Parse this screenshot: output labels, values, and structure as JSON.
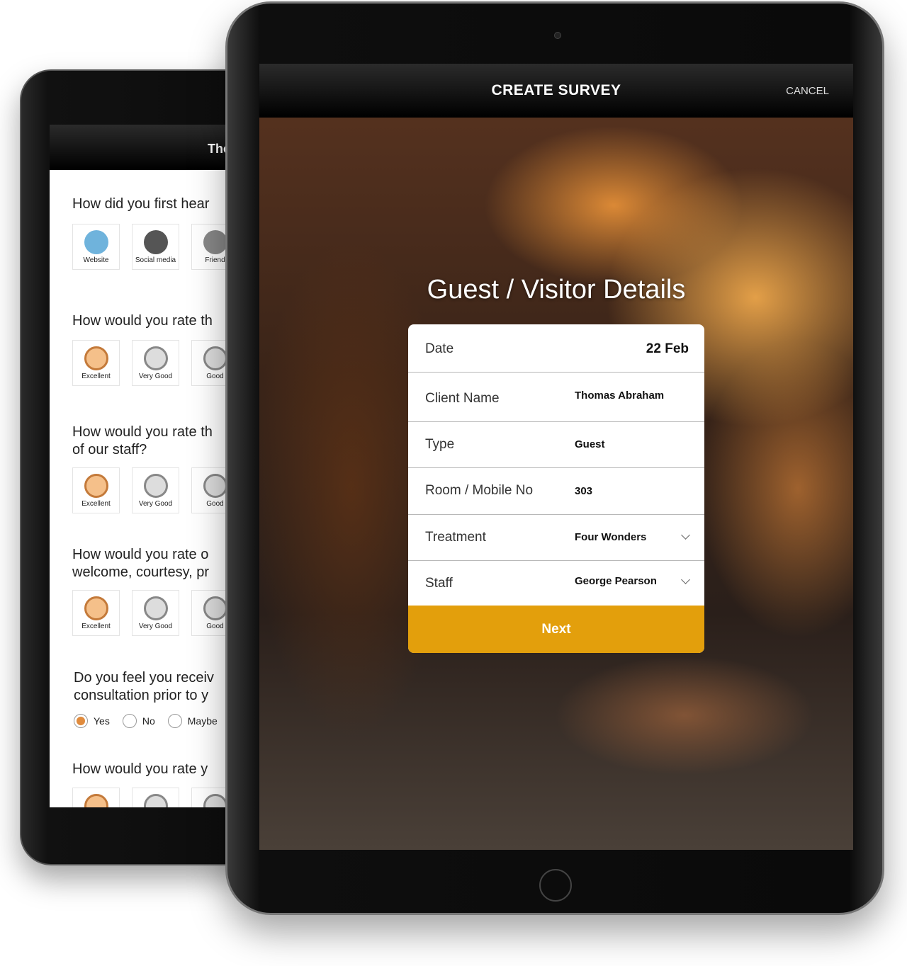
{
  "back_tablet": {
    "header_title": "The",
    "questions": [
      {
        "text": [
          "How did you first hear"
        ],
        "options": [
          {
            "label": "Website",
            "icon": "website-icon"
          },
          {
            "label": "Social media",
            "icon": "camera-icon"
          },
          {
            "label": "Friend",
            "icon": "smiley-icon"
          }
        ]
      },
      {
        "text": [
          "How would you rate th"
        ],
        "options": [
          {
            "label": "Excellent"
          },
          {
            "label": "Very Good"
          },
          {
            "label": "Good"
          }
        ]
      },
      {
        "text": [
          "How would you rate th",
          "of our staff?"
        ],
        "options": [
          {
            "label": "Excellent"
          },
          {
            "label": "Very Good"
          },
          {
            "label": "Good"
          }
        ]
      },
      {
        "text": [
          "How would you rate o",
          "welcome, courtesy, pr"
        ],
        "options": [
          {
            "label": "Excellent"
          },
          {
            "label": "Very Good"
          },
          {
            "label": "Good"
          }
        ]
      },
      {
        "text": [
          "Do you feel you receiv",
          "consultation prior to y"
        ],
        "radios": [
          {
            "label": "Yes",
            "selected": true
          },
          {
            "label": "No",
            "selected": false
          },
          {
            "label": "Maybe",
            "selected": false
          }
        ]
      },
      {
        "text": [
          "How would you rate y"
        ]
      }
    ]
  },
  "front_tablet": {
    "header_title": "CREATE SURVEY",
    "cancel_label": "CANCEL",
    "hero_title": "Guest / Visitor Details",
    "form": {
      "date": {
        "label": "Date",
        "value": "22 Feb"
      },
      "client_name": {
        "label": "Client Name",
        "value": "Thomas Abraham"
      },
      "type": {
        "label": "Type",
        "value": "Guest"
      },
      "room": {
        "label": "Room / Mobile No",
        "value": "303"
      },
      "treatment": {
        "label": "Treatment",
        "value": "Four Wonders"
      },
      "staff": {
        "label": "Staff",
        "value": "George Pearson"
      }
    },
    "next_label": "Next"
  },
  "colors": {
    "accent": "#e39f0c",
    "rating_selected": "#c47a3a"
  }
}
